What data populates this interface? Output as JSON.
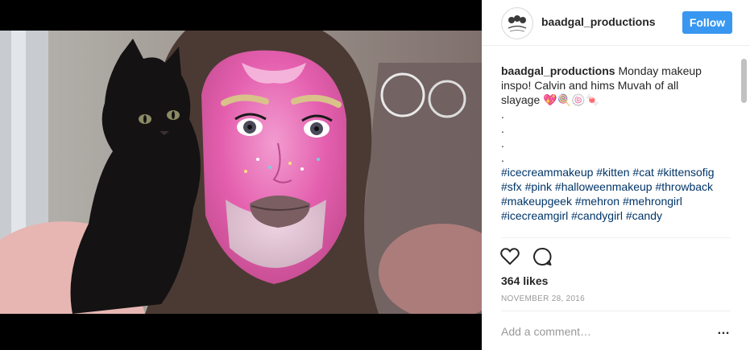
{
  "post": {
    "username": "baadgal_productions",
    "follow_label": "Follow",
    "caption_user": "baadgal_productions",
    "caption_text": "Monday makeup inspo! Calvin and hims Muvah of all slayage 💖🍭🍥🍬",
    "caption_dots": [
      ".",
      ".",
      ".",
      "."
    ],
    "hashtags": "#icecreammakeup #kitten #cat #kittensofig #sfx #pink #halloweenmakeup #throwback #makeupgeek #mehron #mehrongirl #icecreamgirl #candygirl #candy",
    "likes": "364 likes",
    "date": "NOVEMBER 28, 2016",
    "comment_placeholder": "Add a comment…",
    "more_icon": "…"
  },
  "icons": {
    "like": "heart-icon",
    "comment": "comment-icon",
    "more": "more-options-icon"
  },
  "colors": {
    "accent": "#3897f0",
    "hashtag": "#003569",
    "text": "#262626",
    "muted": "#999999",
    "divider": "#efefef"
  }
}
